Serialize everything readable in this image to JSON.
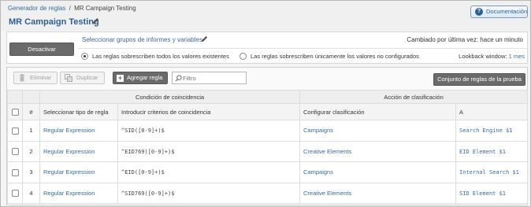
{
  "breadcrumb": {
    "root": "Generador de reglas",
    "separator": "/",
    "current": "MR Campaign Testing"
  },
  "page_title": "MR Campaign Testing",
  "documentation_label": "Documentación",
  "settings": {
    "deactivate_label": "Desactivar",
    "report_suites_link": "Seleccionar grupos de informes y variables",
    "last_changed": "Cambiado por última vez: hace un minuto",
    "radio_overwrite_all": "Las reglas sobrescriben todos los valores existentes",
    "radio_overwrite_unset": "Las reglas sobrescriben únicamente los valores no configurados",
    "selected_radio": "overwrite_all",
    "lookback_label": "Lookback window:",
    "lookback_value": "1 mes"
  },
  "toolbar": {
    "delete_label": "Eliminar",
    "duplicate_label": "Duplicar",
    "add_rule_label": "Agregar regla",
    "filter_placeholder": "Filtro",
    "test_ruleset_label": "Conjunto de reglas de la prueba"
  },
  "table": {
    "group_match": "Condición de coincidencia",
    "group_classification": "Acción de clasificación",
    "col_number": "#",
    "col_rule_type": "Seleccionar tipo de regla",
    "col_match_criteria": "Introducir criterios de coincidencia",
    "col_set_classification": "Configurar clasificación",
    "col_to": "A",
    "rows": [
      {
        "num": "1",
        "rule_type": "Regular Expression",
        "criteria": "^SID([0-9]+)$",
        "classification": "Campaigns",
        "to": "Search Engine $1",
        "num_link": false
      },
      {
        "num": "2",
        "rule_type": "Regular Expression",
        "criteria": "^EID769([0-9]+)$",
        "classification": "Creative Elements",
        "to": "EID Element $1",
        "num_link": false
      },
      {
        "num": "3",
        "rule_type": "Regular Expression",
        "criteria": "^EID([0-9]+)$",
        "classification": "Campaigns",
        "to": "Internal Search $1",
        "num_link": true
      },
      {
        "num": "4",
        "rule_type": "Regular Expression",
        "criteria": "^SID769([0-9]+)$",
        "classification": "Creative Elements",
        "to": "SID Element $1",
        "num_link": false
      }
    ]
  },
  "icons": {
    "title_edit": "pencil-icon",
    "help": "question-icon",
    "report_edit": "pencil-icon",
    "delete": "trash-icon",
    "duplicate": "duplicate-icon",
    "add": "plus-icon",
    "filter": "search-icon"
  },
  "colors": {
    "title_blue": "#2b5f98",
    "link_blue": "#3a6a9d",
    "dark_button": "#6a6a6a"
  }
}
